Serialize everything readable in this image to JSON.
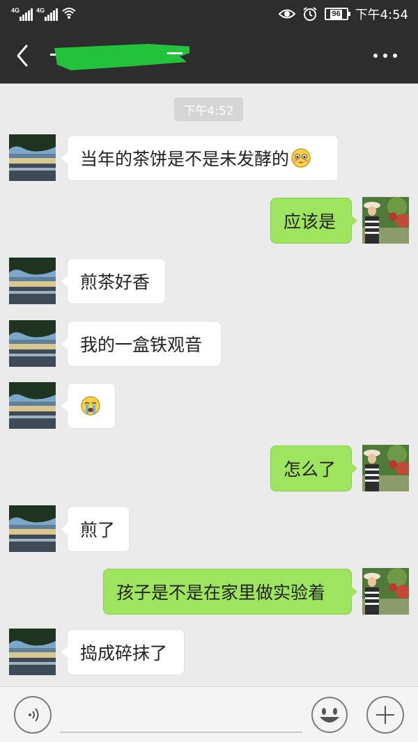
{
  "status_bar": {
    "signal_1_label": "4G",
    "signal_2_label": "4G",
    "battery_level": "96",
    "time": "下午4:54"
  },
  "header": {
    "title": "",
    "title_redacted": true
  },
  "chat": {
    "timestamp": "下午4:52",
    "messages": [
      {
        "side": "in",
        "text": "当年的茶饼是不是未发酵的",
        "emoji": "blush-face"
      },
      {
        "side": "out",
        "text": "应该是"
      },
      {
        "side": "in",
        "text": "煎茶好香"
      },
      {
        "side": "in",
        "text": "我的一盒铁观音"
      },
      {
        "side": "in",
        "text": "",
        "emoji": "crying-face"
      },
      {
        "side": "out",
        "text": "怎么了"
      },
      {
        "side": "in",
        "text": "煎了"
      },
      {
        "side": "out",
        "text": "孩子是不是在家里做实验着"
      },
      {
        "side": "in",
        "text": "捣成碎抹了"
      }
    ]
  },
  "input_bar": {
    "voice_icon": "voice-icon",
    "emoji_icon": "emoji-icon",
    "plus_icon": "plus-icon"
  },
  "colors": {
    "header_bg": "#2d2d2d",
    "chat_bg": "#ebebeb",
    "outgoing_bubble": "#9fe45e",
    "incoming_bubble": "#ffffff",
    "redaction": "#22c33a"
  }
}
